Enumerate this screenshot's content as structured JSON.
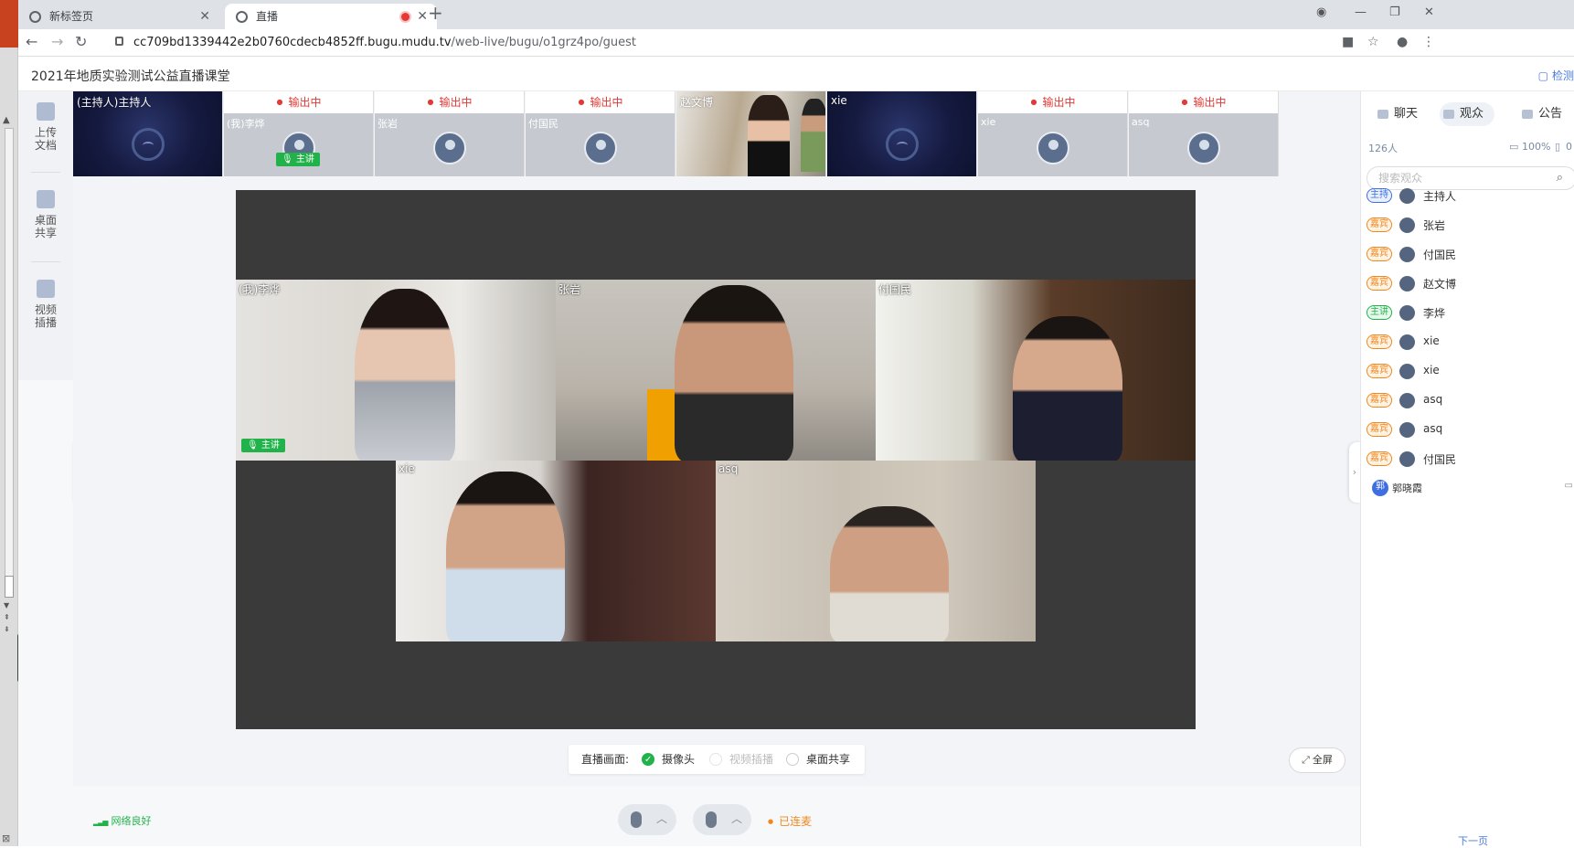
{
  "browser": {
    "tabs": [
      {
        "label": "新标签页"
      },
      {
        "label": "直播"
      }
    ],
    "url_host": "cc709bd1339442e2b0760cdecb4852ff.bugu.mudu.tv",
    "url_path": "/web-live/bugu/o1grz4po/guest"
  },
  "app": {
    "title": "2021年地质实验测试公益直播课堂",
    "detect_label": "检测"
  },
  "left_tools": [
    {
      "label": "上传文档",
      "icon": "upload-doc-icon"
    },
    {
      "label": "桌面共享",
      "icon": "desktop-share-icon"
    },
    {
      "label": "视频插播",
      "icon": "video-insert-icon"
    }
  ],
  "thumbnails": [
    {
      "name": "(主持人)主持人",
      "status": ""
    },
    {
      "name": "(我)李烨",
      "status": "输出中",
      "badge": "主讲"
    },
    {
      "name": "张岩",
      "status": "输出中"
    },
    {
      "name": "付国民",
      "status": "输出中"
    },
    {
      "name": "赵文博",
      "status": ""
    },
    {
      "name": "xie",
      "status": ""
    },
    {
      "name": "xie",
      "status": "输出中"
    },
    {
      "name": "asq",
      "status": "输出中"
    }
  ],
  "stage": {
    "videos": [
      {
        "name": "(我)李烨",
        "badge": "主讲"
      },
      {
        "name": "张岩"
      },
      {
        "name": "付国民"
      },
      {
        "name": "xie"
      },
      {
        "name": "asq"
      }
    ]
  },
  "source_bar": {
    "label": "直播画面:",
    "options": [
      {
        "label": "摄像头",
        "selected": true,
        "disabled": false
      },
      {
        "label": "视频插播",
        "selected": false,
        "disabled": true
      },
      {
        "label": "桌面共享",
        "selected": false,
        "disabled": false
      }
    ]
  },
  "fullscreen_label": "全屏",
  "bottom": {
    "network": "网络良好",
    "connected": "已连麦"
  },
  "right_panel": {
    "tabs": [
      {
        "label": "聊天"
      },
      {
        "label": "观众"
      },
      {
        "label": "公告"
      }
    ],
    "count": "126人",
    "percent": "100%",
    "percent2": "0",
    "search_placeholder": "搜索观众",
    "audience": [
      {
        "role": "主持",
        "role_type": "host",
        "name": "主持人"
      },
      {
        "role": "嘉宾",
        "role_type": "guest",
        "name": "张岩"
      },
      {
        "role": "嘉宾",
        "role_type": "guest",
        "name": "付国民"
      },
      {
        "role": "嘉宾",
        "role_type": "guest",
        "name": "赵文博"
      },
      {
        "role": "主讲",
        "role_type": "speaker",
        "name": "李烨"
      },
      {
        "role": "嘉宾",
        "role_type": "guest",
        "name": "xie"
      },
      {
        "role": "嘉宾",
        "role_type": "guest",
        "name": "xie"
      },
      {
        "role": "嘉宾",
        "role_type": "guest",
        "name": "asq"
      },
      {
        "role": "嘉宾",
        "role_type": "guest",
        "name": "asq"
      },
      {
        "role": "嘉宾",
        "role_type": "guest",
        "name": "付国民"
      },
      {
        "role": "郭",
        "role_type": "round",
        "name": "郭晓霞"
      }
    ],
    "next_page": "下一页"
  },
  "colors": {
    "accent": "#4a7de0",
    "live_red": "#e53935",
    "speaker_green": "#21b34a",
    "guest_orange": "#f0881c"
  }
}
